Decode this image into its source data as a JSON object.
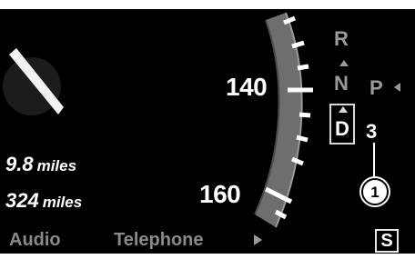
{
  "speedometer": {
    "labels": [
      "140",
      "160"
    ]
  },
  "trip_info": [
    {
      "value": "9.8",
      "unit": "miles"
    },
    {
      "value": "324",
      "unit": "miles"
    }
  ],
  "menu": {
    "audio": "Audio",
    "telephone": "Telephone"
  },
  "gear_indicator": {
    "reverse": "R",
    "neutral": "N",
    "park": "P",
    "drive": "D",
    "current_gear": "3"
  },
  "callout": {
    "label": "1"
  },
  "sport_mode": {
    "label": "S"
  },
  "colors": {
    "background": "#000000",
    "text_primary": "#ffffff",
    "text_secondary": "#9a9a9a",
    "scale_band": "#6e6e6e"
  },
  "icons": {
    "menu_arrow": "triangle-right-icon",
    "gear_up": "triangle-up-icon",
    "park_pointer": "triangle-left-icon"
  }
}
